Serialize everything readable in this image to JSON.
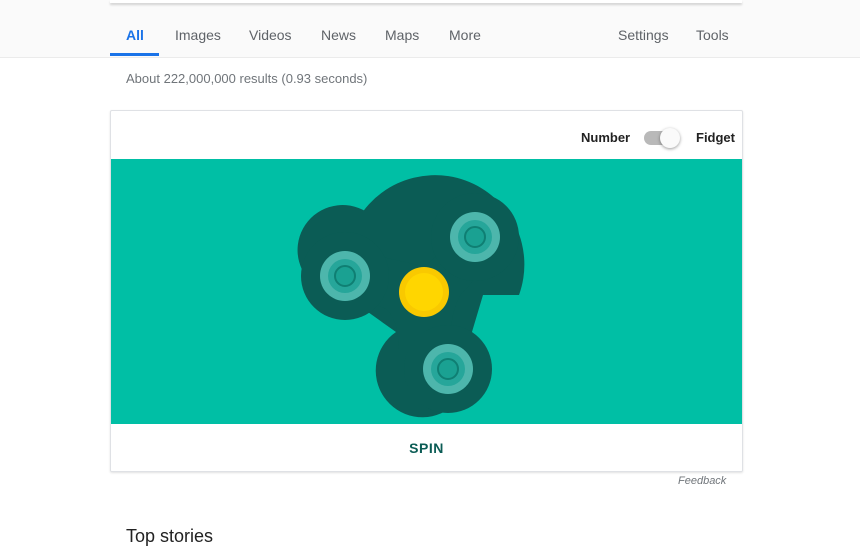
{
  "nav": {
    "tabs": [
      {
        "label": "All",
        "active": true
      },
      {
        "label": "Images"
      },
      {
        "label": "Videos"
      },
      {
        "label": "News"
      },
      {
        "label": "Maps"
      },
      {
        "label": "More"
      }
    ],
    "settings_label": "Settings",
    "tools_label": "Tools"
  },
  "results": {
    "stats": "About 222,000,000 results (0.93 seconds)"
  },
  "widget": {
    "mode_left_label": "Number",
    "mode_right_label": "Fidget",
    "mode": "Fidget",
    "spin_label": "SPIN",
    "colors": {
      "background": "#00bfa5",
      "spinner_body": "#0b5c55",
      "bearing_outer": "#4db6ac",
      "bearing_inner": "#26a69a",
      "center": "#ffd600"
    }
  },
  "feedback_label": "Feedback",
  "section_title": "Top stories"
}
